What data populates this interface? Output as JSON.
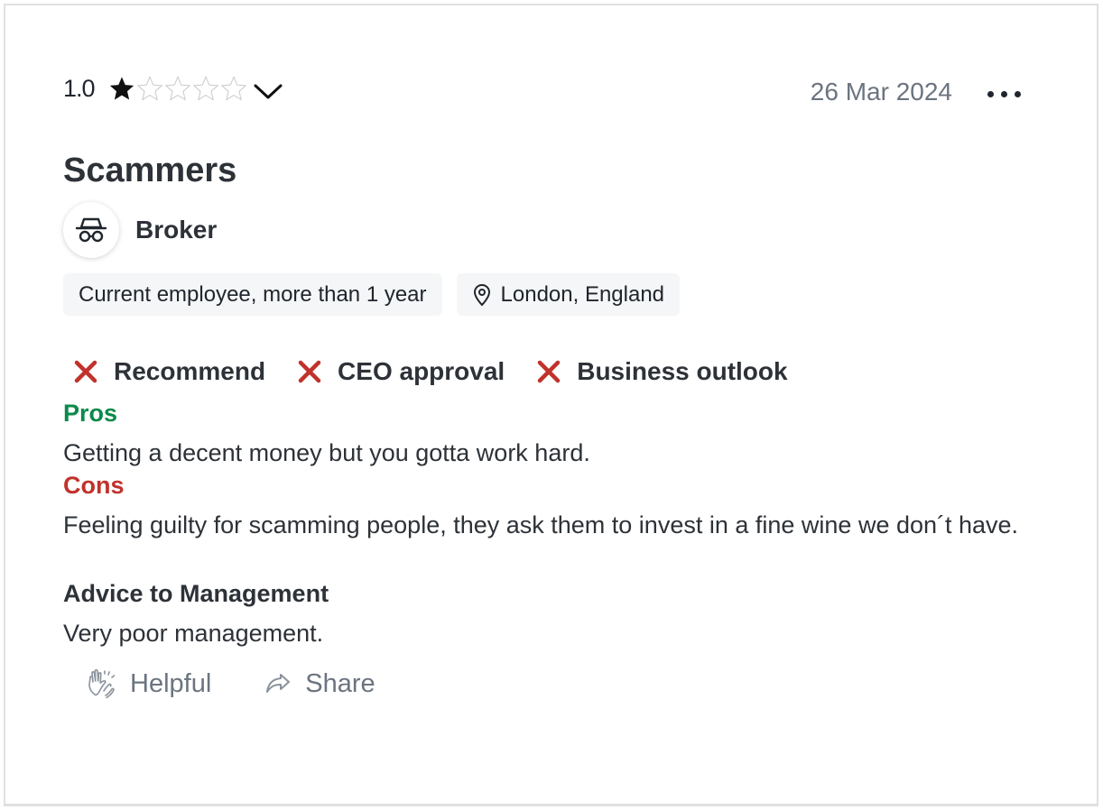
{
  "review": {
    "rating": "1.0",
    "stars_filled": 1,
    "stars_total": 5,
    "date": "26 Mar 2024",
    "title": "Scammers",
    "job_title": "Broker",
    "employment_status": "Current employee, more than 1 year",
    "location": "London, England",
    "verdicts": [
      {
        "label": "Recommend",
        "value": "no",
        "icon": "x-icon"
      },
      {
        "label": "CEO approval",
        "value": "no",
        "icon": "x-icon"
      },
      {
        "label": "Business outlook",
        "value": "no",
        "icon": "x-icon"
      }
    ],
    "pros_label": "Pros",
    "pros_text": "Getting a decent money but you gotta work hard.",
    "cons_label": "Cons",
    "cons_text": "Feeling guilty for scamming people, they ask them to invest in a fine wine we don´t have.",
    "advice_label": "Advice to Management",
    "advice_text": "Very poor management.",
    "actions": {
      "helpful_label": "Helpful",
      "share_label": "Share"
    }
  },
  "colors": {
    "pros": "#0b8a4a",
    "cons": "#c0322b",
    "verdict_no": "#c0322b",
    "muted": "#6b7480",
    "text": "#20262e"
  }
}
